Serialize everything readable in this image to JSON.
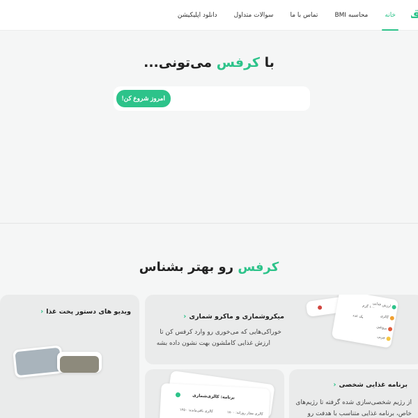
{
  "header": {
    "logo": "قی",
    "nav": [
      {
        "label": "خانه",
        "active": true
      },
      {
        "label": "محاسبه BMI",
        "active": false
      },
      {
        "label": "تماس با ما",
        "active": false
      },
      {
        "label": "سوالات متداول",
        "active": false
      },
      {
        "label": "دانلود اپلیکیشن",
        "active": false
      }
    ]
  },
  "hero": {
    "title_prefix": "با ",
    "title_brand": "کرفس",
    "title_suffix": " می‌تونی...",
    "cta_label": "امروز شروع کن!"
  },
  "features": {
    "title_brand": "کرفس",
    "title_suffix": " رو بهتر بشناس",
    "micro": {
      "title": "میکروشماری و ماکرو شماری",
      "line1": "خوراکی‌هایی که می‌خوری رو وارد کرفس کن تا",
      "line2": "ارزش غذایی کاملشون بهت نشون داده بشه"
    },
    "video": {
      "title": "ویدیو های دستور پخت غذا"
    },
    "plan": {
      "title": "برنامه غذایی شخصی",
      "line1": "از رژیم شخصی‌سازی شده گرفته تا رژیم‌های",
      "line2": "خاص، برنامه غذایی متناسب با هدفت رو"
    },
    "mock": {
      "calorie_counter": "کالری‌شماری",
      "allowed_calories": "کالری مجاز روزانه: ۱۸۰۰",
      "remaining_calories": "کالری باقی‌مانده: ۱۲۵۰",
      "program_label": "برنامه:",
      "item_a": "ارزش غذایی",
      "item_b": "کالری",
      "item_c": "پروتئین",
      "item_d": "چربی",
      "item_e": "۱۰۰ گرم",
      "item_f": "یک عدد"
    }
  },
  "colors": {
    "accent": "#2dc38a",
    "background": "#f5f6f6",
    "card": "#eaebeb"
  }
}
